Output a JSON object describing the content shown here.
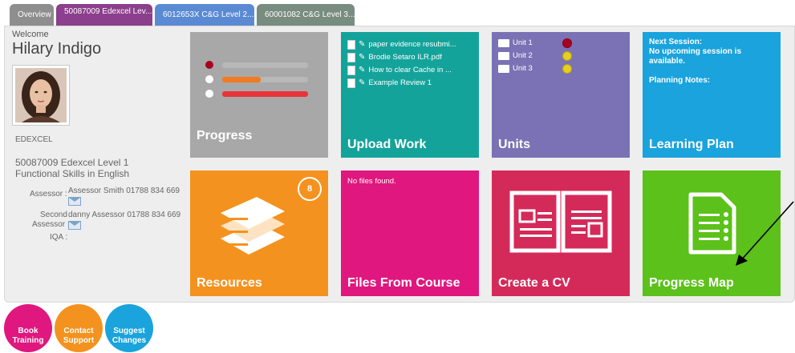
{
  "tabs": [
    {
      "label": "Overview"
    },
    {
      "label": "50087009 Edexcel Lev..."
    },
    {
      "label": "6012653X C&G Level 2..."
    },
    {
      "label": "60001082 C&G Level 3..."
    }
  ],
  "profile": {
    "welcome": "Welcome",
    "name": "Hilary Indigo",
    "provider": "EDEXCEL",
    "course": "50087009 Edexcel Level 1 Functional Skills in English",
    "assessor_label": "Assessor :",
    "assessor_value": "Assessor Smith 01788 834 669",
    "second_label_1": "Second",
    "second_label_2": "Assessor :",
    "second_value": "danny Assessor 01788 834 669",
    "iqa_label": "IQA :"
  },
  "tiles": {
    "progress": {
      "label": "Progress"
    },
    "upload": {
      "label": "Upload Work",
      "files": [
        "paper evidence resubmi...",
        "Brodie Setaro ILR.pdf",
        "How to clear Cache in ...",
        "Example Review 1"
      ]
    },
    "units": {
      "label": "Units",
      "items": [
        {
          "name": "Unit 1",
          "status_color": "#a8001e"
        },
        {
          "name": "Unit 2",
          "status_color": "#e6cf1e"
        },
        {
          "name": "Unit 3",
          "status_color": "#e6cf1e"
        }
      ]
    },
    "plan": {
      "label": "Learning Plan",
      "next_session": "Next Session:",
      "no_session": "No upcoming session is available.",
      "notes": "Planning Notes:"
    },
    "resources": {
      "label": "Resources",
      "count": "8"
    },
    "files": {
      "label": "Files From Course",
      "empty": "No files found."
    },
    "cv": {
      "label": "Create a CV"
    },
    "map": {
      "label": "Progress Map"
    }
  },
  "actions": {
    "book": [
      "Book",
      "Training"
    ],
    "contact": [
      "Contact",
      "Support"
    ],
    "suggest": [
      "Suggest",
      "Changes"
    ]
  },
  "progress_bars": {
    "bar1": 0.0,
    "bar2": 0.45,
    "bar3": 1.0,
    "status_colors": [
      "#a8001e",
      "#ffffff",
      "#ffffff"
    ]
  }
}
